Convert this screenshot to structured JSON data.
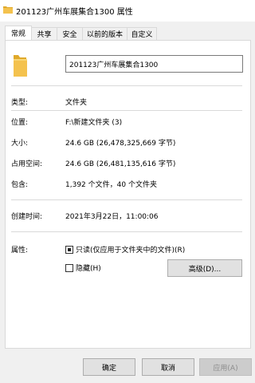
{
  "window": {
    "title": "201123广州车展集合1300 属性"
  },
  "tabs": [
    "常规",
    "共享",
    "安全",
    "以前的版本",
    "自定义"
  ],
  "name_field": {
    "value": "201123广州车展集合1300"
  },
  "props": [
    {
      "label": "类型:",
      "value": "文件夹"
    },
    {
      "label": "位置:",
      "value": "F:\\新建文件夹 (3)"
    },
    {
      "label": "大小:",
      "value": "24.6 GB (26,478,325,669 字节)"
    },
    {
      "label": "占用空间:",
      "value": "24.6 GB (26,481,135,616 字节)"
    },
    {
      "label": "包含:",
      "value": "1,392 个文件，40 个文件夹"
    },
    {
      "label": "创建时间:",
      "value": "2021年3月22日，11:00:06"
    }
  ],
  "attributes": {
    "label": "属性:",
    "readonly_label": "只读(仅应用于文件夹中的文件)(R)",
    "readonly_checked": true,
    "hidden_label": "隐藏(H)",
    "hidden_checked": false,
    "advanced_label": "高级(D)..."
  },
  "buttons": {
    "ok": "确定",
    "cancel": "取消",
    "apply": "应用(A)"
  },
  "colors": {
    "folder": "#f4c24e",
    "folder_dark": "#e0a92b",
    "panel_border": "#d9d9d9"
  },
  "icons": {
    "title": "folder-icon",
    "main": "folder-icon"
  }
}
